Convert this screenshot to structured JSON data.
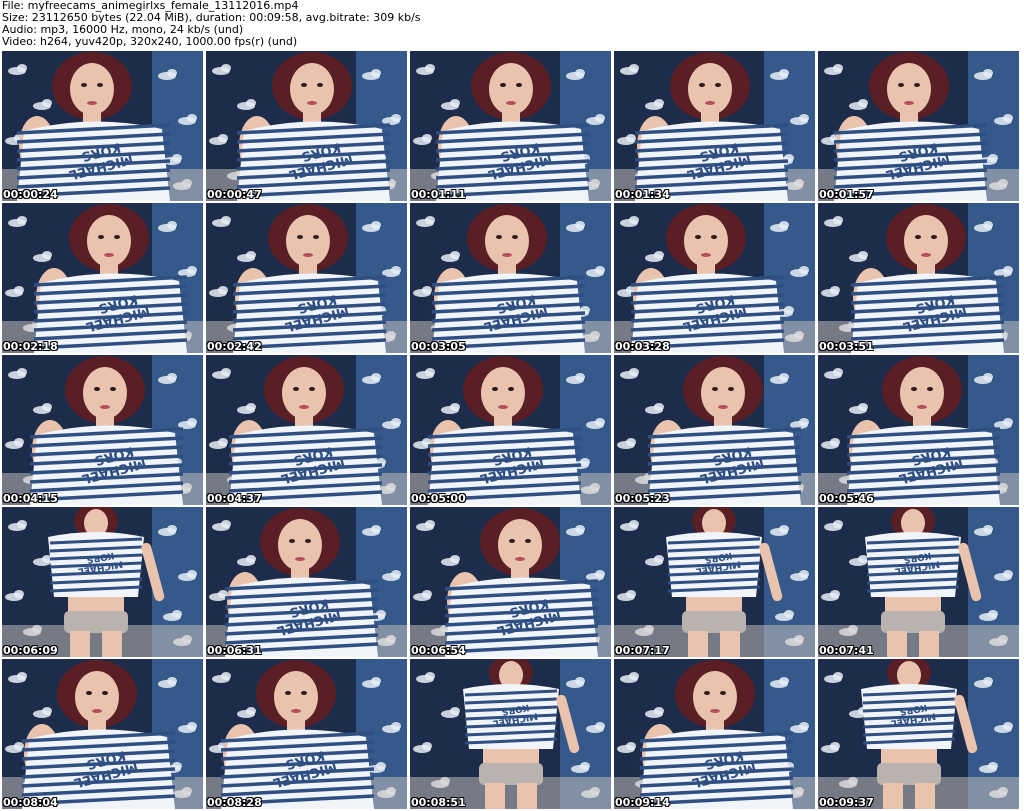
{
  "header": {
    "file_line": "File: myfreecams_animegirlxs_female_13112016.mp4",
    "size_line": "Size: 23112650 bytes (22.04 MiB), duration: 00:09:58, avg.bitrate: 309 kb/s",
    "audio_line": "Audio: mp3, 16000 Hz, mono, 24 kb/s (und)",
    "video_line": "Video: h264, yuv420p, 320x240, 1000.00 fps(r) (und)"
  },
  "shirt_text": [
    "MICHAEL",
    "KORS"
  ],
  "colors": {
    "wall_dark": "#1c2c4a",
    "wall_light": "#4a7fc0",
    "cloud": "#e8eef6",
    "skin": "#e9c3ad",
    "hair": "#5a1f24",
    "shirt": "#f1f4f8",
    "stripe": "#2f4f82",
    "floor": "#cfc8c2",
    "shorts": "#b9b2ae"
  },
  "thumbnails": [
    {
      "timestamp": "00:00:24",
      "pose": "upper"
    },
    {
      "timestamp": "00:00:47",
      "pose": "upper"
    },
    {
      "timestamp": "00:01:11",
      "pose": "upper"
    },
    {
      "timestamp": "00:01:34",
      "pose": "upper"
    },
    {
      "timestamp": "00:01:57",
      "pose": "upper"
    },
    {
      "timestamp": "00:02:18",
      "pose": "upper"
    },
    {
      "timestamp": "00:02:42",
      "pose": "upper"
    },
    {
      "timestamp": "00:03:05",
      "pose": "upper"
    },
    {
      "timestamp": "00:03:28",
      "pose": "upper"
    },
    {
      "timestamp": "00:03:51",
      "pose": "upper"
    },
    {
      "timestamp": "00:04:15",
      "pose": "upper"
    },
    {
      "timestamp": "00:04:37",
      "pose": "upper"
    },
    {
      "timestamp": "00:05:00",
      "pose": "upper"
    },
    {
      "timestamp": "00:05:23",
      "pose": "upper"
    },
    {
      "timestamp": "00:05:46",
      "pose": "upper"
    },
    {
      "timestamp": "00:06:09",
      "pose": "full"
    },
    {
      "timestamp": "00:06:31",
      "pose": "upper"
    },
    {
      "timestamp": "00:06:54",
      "pose": "upper"
    },
    {
      "timestamp": "00:07:17",
      "pose": "full"
    },
    {
      "timestamp": "00:07:41",
      "pose": "full"
    },
    {
      "timestamp": "00:08:04",
      "pose": "upper"
    },
    {
      "timestamp": "00:08:28",
      "pose": "upper"
    },
    {
      "timestamp": "00:08:51",
      "pose": "full"
    },
    {
      "timestamp": "00:09:14",
      "pose": "upper"
    },
    {
      "timestamp": "00:09:37",
      "pose": "full"
    }
  ]
}
